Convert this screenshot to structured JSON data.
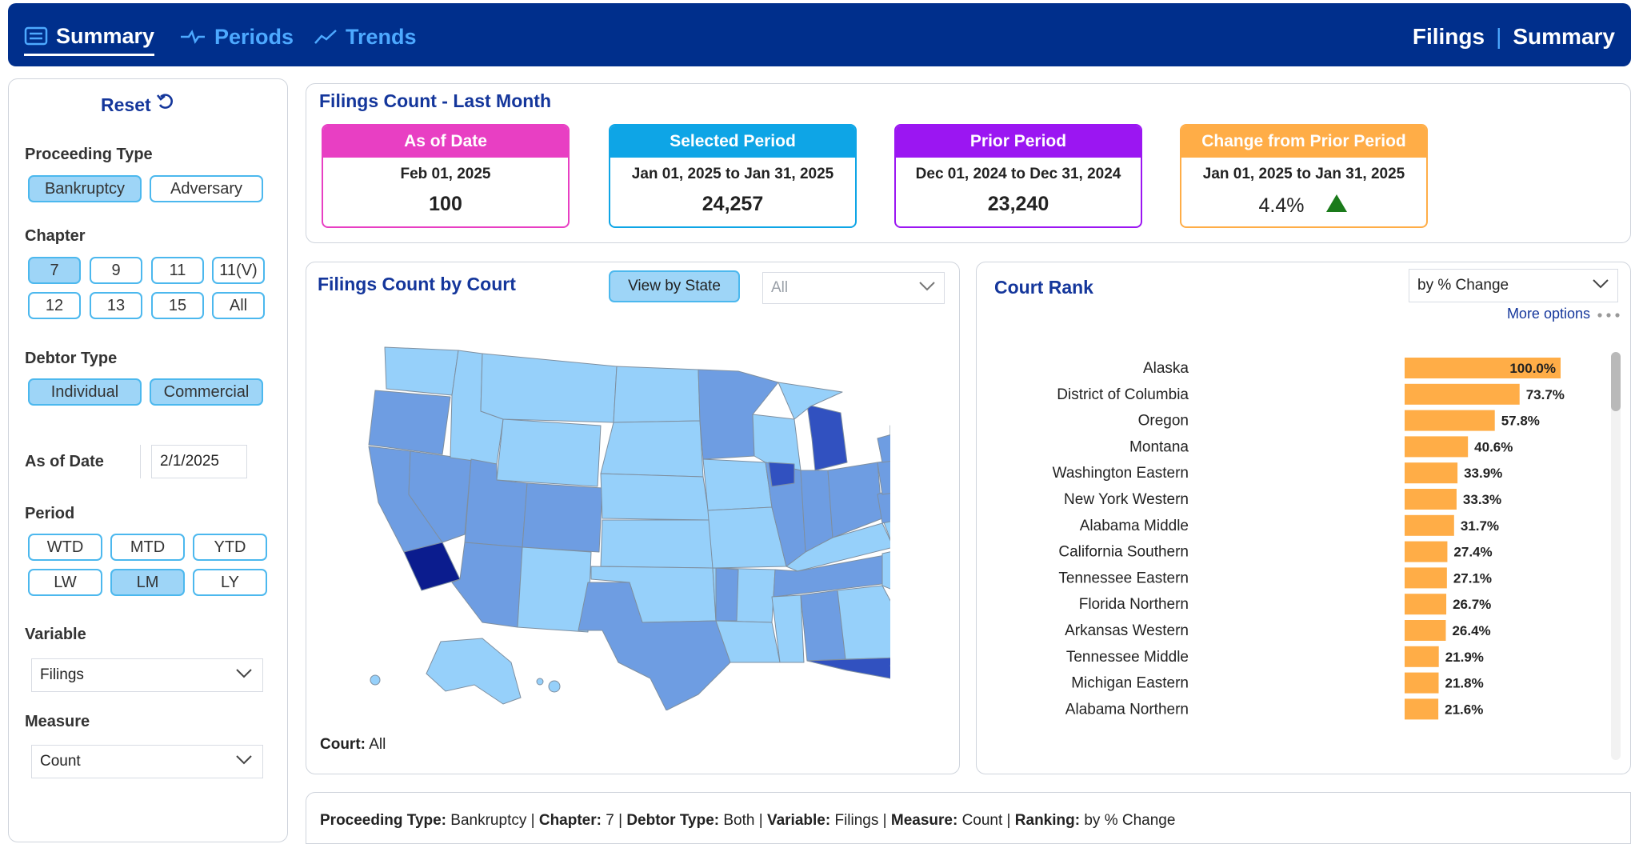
{
  "nav": {
    "tabs": [
      {
        "label": "Summary",
        "icon": "summary-icon",
        "active": true
      },
      {
        "label": "Periods",
        "icon": "periods-icon",
        "active": false
      },
      {
        "label": "Trends",
        "icon": "trends-icon",
        "active": false
      }
    ],
    "brand_left": "Filings",
    "brand_sep": "|",
    "brand_right": "Summary"
  },
  "filters": {
    "reset_label": "Reset",
    "proceeding_type": {
      "label": "Proceeding Type",
      "options": [
        "Bankruptcy",
        "Adversary"
      ],
      "selected": [
        "Bankruptcy"
      ]
    },
    "chapter": {
      "label": "Chapter",
      "options": [
        "7",
        "9",
        "11",
        "11(V)",
        "12",
        "13",
        "15",
        "All"
      ],
      "selected": [
        "7"
      ]
    },
    "debtor_type": {
      "label": "Debtor Type",
      "options": [
        "Individual",
        "Commercial"
      ],
      "selected": [
        "Individual",
        "Commercial"
      ]
    },
    "as_of_date": {
      "label": "As of Date",
      "value": "2/1/2025"
    },
    "period": {
      "label": "Period",
      "options": [
        "WTD",
        "MTD",
        "YTD",
        "LW",
        "LM",
        "LY"
      ],
      "selected": [
        "LM"
      ]
    },
    "variable": {
      "label": "Variable",
      "value": "Filings"
    },
    "measure": {
      "label": "Measure",
      "value": "Count"
    }
  },
  "kpis": {
    "title": "Filings Count - Last Month",
    "cards": [
      {
        "head": "As of Date",
        "sub": "Feb 01, 2025",
        "value": "100",
        "color": "#e83fc3"
      },
      {
        "head": "Selected Period",
        "sub": "Jan 01, 2025 to Jan 31, 2025",
        "value": "24,257",
        "color": "#0ea5e6"
      },
      {
        "head": "Prior Period",
        "sub": "Dec 01, 2024 to Dec 31, 2024",
        "value": "23,240",
        "color": "#9b16f2"
      },
      {
        "head": "Change from Prior Period",
        "sub": "Jan 01, 2025 to Jan 31, 2025",
        "value": "4.4%",
        "color": "#ffad47",
        "trend": "up"
      }
    ],
    "trend_up_color": "#1a7a1a"
  },
  "map": {
    "title": "Filings Count by Court",
    "view_button": "View by State",
    "court_filter": "All",
    "court_caption_label": "Court:",
    "court_caption_value": "All",
    "colors": {
      "light": "#96d0fa",
      "mid": "#6e9de2",
      "dark": "#3151c0",
      "darkest": "#0b1c8e",
      "border": "#7e8fa0"
    }
  },
  "rank": {
    "title": "Court Rank",
    "sort_by": "by % Change",
    "more_options": "More options",
    "bar_color": "#ffad47",
    "chart_data": {
      "type": "bar",
      "categories": [
        "Alaska",
        "District of Columbia",
        "Oregon",
        "Montana",
        "Washington Eastern",
        "New York Western",
        "Alabama Middle",
        "California Southern",
        "Tennessee Eastern",
        "Florida Northern",
        "Arkansas Western",
        "Tennessee Middle",
        "Michigan Eastern",
        "Alabama Northern"
      ],
      "values": [
        100.0,
        73.7,
        57.8,
        40.6,
        33.9,
        33.3,
        31.7,
        27.4,
        27.1,
        26.7,
        26.4,
        21.9,
        21.8,
        21.6
      ],
      "labels": [
        "100.0%",
        "73.7%",
        "57.8%",
        "40.6%",
        "33.9%",
        "33.3%",
        "31.7%",
        "27.4%",
        "27.1%",
        "26.7%",
        "26.4%",
        "21.9%",
        "21.8%",
        "21.6%"
      ],
      "xlim": [
        0,
        100
      ]
    }
  },
  "footer": {
    "items": [
      {
        "label": "Proceeding Type:",
        "value": "Bankruptcy"
      },
      {
        "label": "Chapter:",
        "value": "7"
      },
      {
        "label": "Debtor Type:",
        "value": "Both"
      },
      {
        "label": "Variable:",
        "value": "Filings"
      },
      {
        "label": "Measure:",
        "value": "Count"
      },
      {
        "label": "Ranking:",
        "value": "by % Change"
      }
    ]
  }
}
